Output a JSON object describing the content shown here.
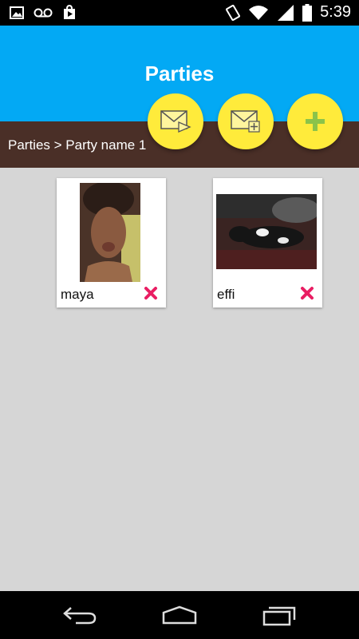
{
  "status_bar": {
    "time": "5:39",
    "left_icons": [
      "image-icon",
      "voicemail-icon",
      "play-store-icon"
    ],
    "right_icons": [
      "vibrate-icon",
      "wifi-icon",
      "signal-icon",
      "battery-icon"
    ]
  },
  "header": {
    "title": "Parties"
  },
  "breadcrumb": {
    "text": "Parties > Party name 1"
  },
  "fabs": [
    {
      "icon": "send-mail-icon"
    },
    {
      "icon": "add-mail-icon"
    },
    {
      "icon": "plus-icon"
    }
  ],
  "guests": [
    {
      "name": "maya"
    },
    {
      "name": "effi"
    }
  ],
  "colors": {
    "header": "#03a9f4",
    "breadcrumb_bar": "#4a2f27",
    "fab": "#ffeb3b",
    "remove": "#e91e63",
    "plus": "#8bc34a",
    "background": "#d6d6d6"
  },
  "nav_bar": {
    "buttons": [
      "back-icon",
      "home-icon",
      "recent-apps-icon"
    ]
  }
}
